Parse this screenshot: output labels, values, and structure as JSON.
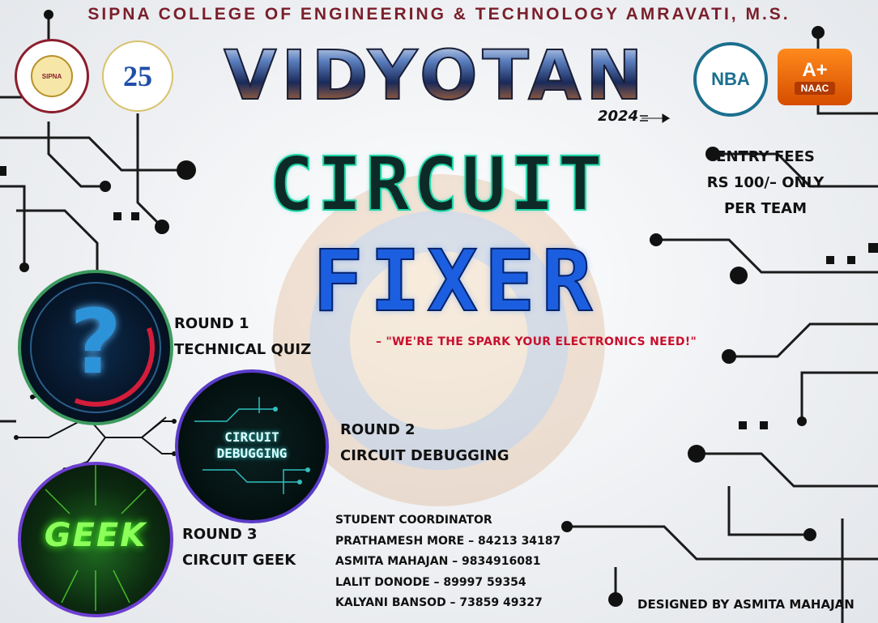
{
  "header": {
    "college": "SIPNA COLLEGE OF ENGINEERING & TECHNOLOGY AMRAVATI, M.S."
  },
  "logos": {
    "sipna": "SIPNA",
    "anniversary": "25",
    "nba": "NBA",
    "naac_grade": "A+",
    "naac": "NAAC"
  },
  "event": {
    "fest_name": "VIDYOTAN",
    "fest_year": "2024",
    "title_line1": "CIRCUIT",
    "title_line2": "FIXER",
    "tagline": "– \"WE'RE THE SPARK YOUR ELECTRONICS NEED!\""
  },
  "fees": [
    "ENTRY FEES",
    "RS 100/– ONLY",
    "PER TEAM"
  ],
  "rounds": [
    {
      "round": "ROUND 1",
      "name": "TECHNICAL QUIZ",
      "image_text": "?"
    },
    {
      "round": "ROUND 2",
      "name": "CIRCUIT DEBUGGING",
      "image_text_1": "CIRCUIT",
      "image_text_2": "DEBUGGING"
    },
    {
      "round": "ROUND 3",
      "name": "CIRCUIT GEEK",
      "image_text": "GEEK"
    }
  ],
  "coordinators": {
    "heading": "STUDENT COORDINATOR",
    "people": [
      "PRATHAMESH MORE – 84213 34187",
      "ASMITA MAHAJAN – 9834916081",
      "LALIT DONODE – 89997 59354",
      "KALYANI BANSOD – 73859 49327"
    ]
  },
  "credit": "DESIGNED BY ASMITA MAHAJAN",
  "colors": {
    "college": "#7a1f2b",
    "circuit": "#1dd4a6",
    "fixer": "#1b5fe0",
    "tagline": "#c8102e"
  },
  "icons": [
    "rocket-icon",
    "question-mark-icon",
    "circuit-trace-icon"
  ]
}
